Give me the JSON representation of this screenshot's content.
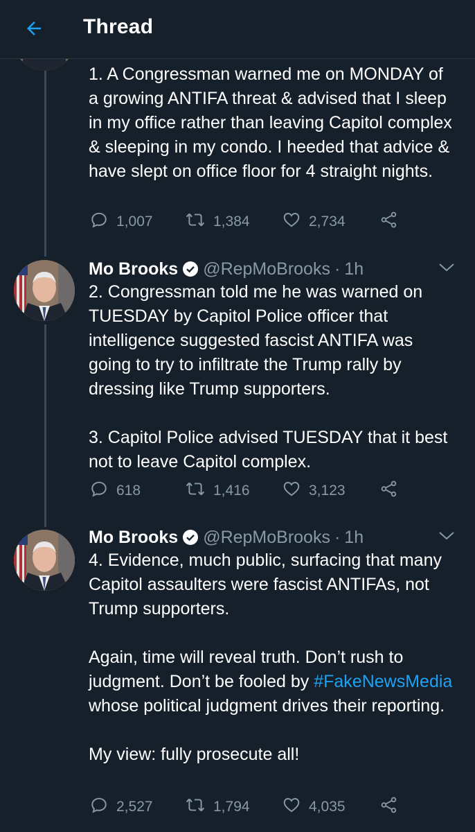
{
  "header": {
    "title": "Thread"
  },
  "colors": {
    "background": "#15202b",
    "text": "#ffffff",
    "muted": "#8899a6",
    "accent": "#1da1f2",
    "thread_line": "#3d4a56"
  },
  "tweets": [
    {
      "text": "1. A Congressman warned me on MONDAY of a growing ANTIFA threat & advised that I sleep in my office rather than leaving Capitol complex & sleeping in my condo. I heeded that advice & have slept on office floor for 4 straight nights.",
      "stats": {
        "replies": "1,007",
        "retweets": "1,384",
        "likes": "2,734"
      }
    },
    {
      "author": "Mo Brooks",
      "handle": "@RepMoBrooks",
      "time": "1h",
      "text": "2. Congressman told me he was warned on TUESDAY by Capitol Police officer that intelligence suggested fascist ANTIFA was going to try to infiltrate the Trump rally by dressing like Trump supporters.\n\n3. Capitol Police advised TUESDAY that it best not to leave Capitol complex.",
      "stats": {
        "replies": "618",
        "retweets": "1,416",
        "likes": "3,123"
      }
    },
    {
      "author": "Mo Brooks",
      "handle": "@RepMoBrooks",
      "time": "1h",
      "text_before": "4. Evidence, much public, surfacing that many Capitol assaulters were fascist ANTIFAs, not Trump supporters.\n\nAgain, time will reveal truth. Don’t rush to judgment. Don’t be fooled by ",
      "hashtag": "#FakeNewsMedia",
      "text_after": " whose political judgment drives their reporting.\n\nMy view: fully prosecute all!",
      "stats": {
        "replies": "2,527",
        "retweets": "1,794",
        "likes": "4,035"
      }
    }
  ]
}
